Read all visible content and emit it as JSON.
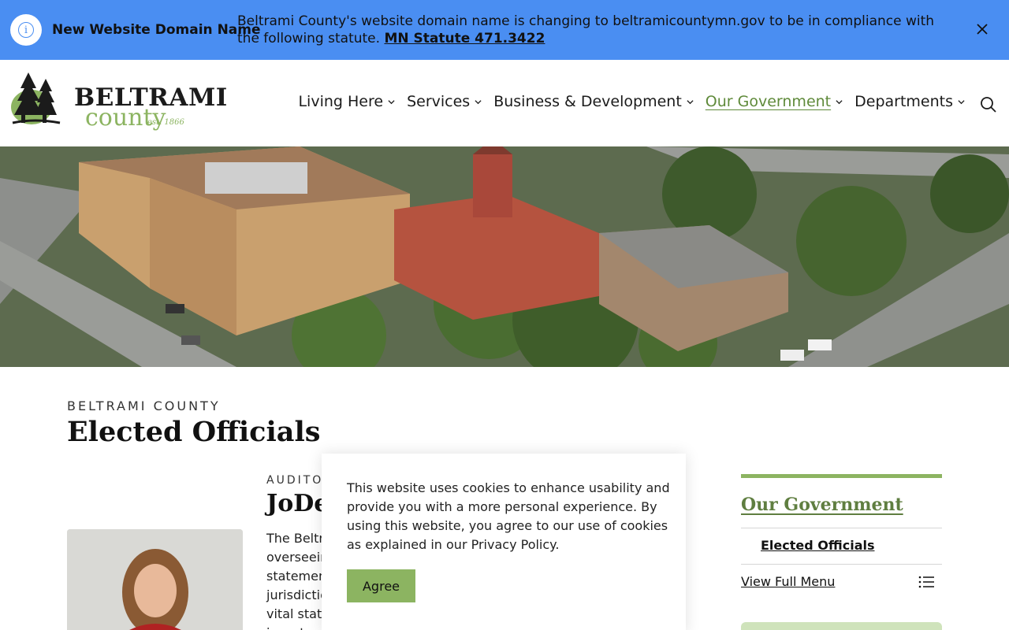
{
  "alert": {
    "title": "New Website Domain Name",
    "message": "Beltrami County's website domain name is changing to beltramicountymn.gov to be in compliance with the following statute.",
    "link_text": "MN Statute 471.3422",
    "close_icon": "close-icon",
    "info_icon": "info-icon",
    "color": "#4a8ef2"
  },
  "header": {
    "logo": {
      "word": "BELTRAMI",
      "sub": "county",
      "est": "est. 1866"
    },
    "nav": [
      {
        "label": "Living Here"
      },
      {
        "label": "Services"
      },
      {
        "label": "Business & Development"
      },
      {
        "label": "Our Government",
        "active": true
      },
      {
        "label": "Departments"
      }
    ],
    "search_icon": "search-icon",
    "active_color": "#5f8a3a"
  },
  "page": {
    "eyebrow": "BELTRAMI COUNTY",
    "title": "Elected Officials"
  },
  "official": {
    "role": "AUDITO",
    "name": "JoDe",
    "body_lines": [
      "The Beltra",
      "overseein",
      "statemen",
      "jurisdictio",
      "vital statis",
      "investmen"
    ]
  },
  "sidebar": {
    "title": "Our Government",
    "items": [
      {
        "label": "Elected Officials"
      }
    ],
    "view_menu": "View Full Menu",
    "accent": "#8cb461"
  },
  "cookie": {
    "text": "This website uses cookies to enhance usability and provide you with a more personal experience. By using this website, you agree to our use of cookies as explained in our Privacy Policy.",
    "button": "Agree"
  }
}
